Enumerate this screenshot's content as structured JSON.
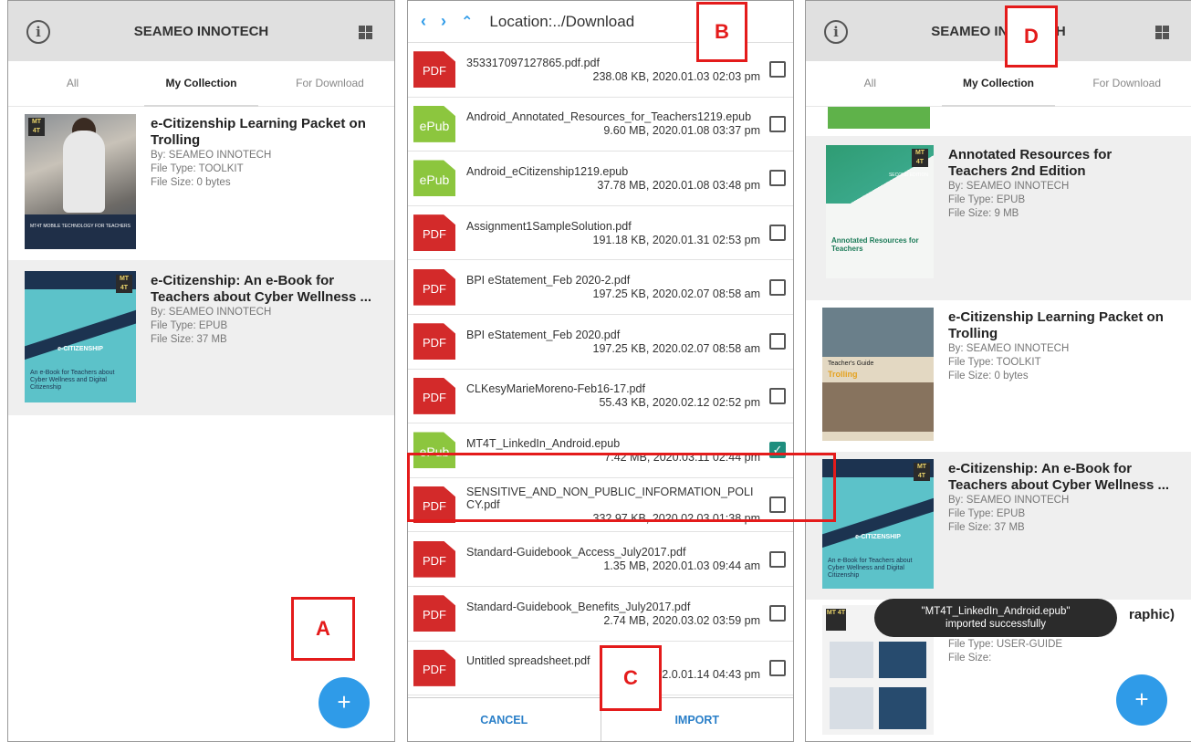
{
  "app": {
    "title": "SEAMEO INNOTECH",
    "info_icon": "info-icon",
    "grid_icon": "grid-view-icon",
    "tabs": [
      "All",
      "My Collection",
      "For Download"
    ]
  },
  "panel1": {
    "cards": [
      {
        "title": "e-Citizenship Learning Packet on Trolling",
        "by": "By: SEAMEO INNOTECH",
        "type": "File Type: TOOLKIT",
        "size": "File Size: 0 bytes",
        "cover_text": "MT4T MOBILE TECHNOLOGY FOR TEACHERS"
      },
      {
        "title": "e-Citizenship: An e-Book for Teachers about Cyber Wellness ...",
        "by": "By: SEAMEO INNOTECH",
        "type": "File Type: EPUB",
        "size": "File Size: 37 MB",
        "cover_text": "e-CITIZENSHIP",
        "cover_note": "An e-Book for Teachers about Cyber Wellness and Digital Citizenship"
      }
    ],
    "fab": "+"
  },
  "panel2": {
    "location": "Location:../Download",
    "files": [
      {
        "icon": "PDF",
        "name": "353317097127865.pdf.pdf",
        "meta": "238.08 KB, 2020.01.03 02:03 pm",
        "checked": false
      },
      {
        "icon": "ePub",
        "name": "Android_Annotated_Resources_for_Teachers1219.epub",
        "meta": "9.60 MB, 2020.01.08 03:37 pm",
        "checked": false
      },
      {
        "icon": "ePub",
        "name": "Android_eCitizenship1219.epub",
        "meta": "37.78 MB, 2020.01.08 03:48 pm",
        "checked": false
      },
      {
        "icon": "PDF",
        "name": "Assignment1SampleSolution.pdf",
        "meta": "191.18 KB, 2020.01.31 02:53 pm",
        "checked": false
      },
      {
        "icon": "PDF",
        "name": "BPI eStatement_Feb 2020-2.pdf",
        "meta": "197.25 KB, 2020.02.07 08:58 am",
        "checked": false
      },
      {
        "icon": "PDF",
        "name": "BPI eStatement_Feb 2020.pdf",
        "meta": "197.25 KB, 2020.02.07 08:58 am",
        "checked": false
      },
      {
        "icon": "PDF",
        "name": "CLKesyMarieMoreno-Feb16-17.pdf",
        "meta": "55.43 KB, 2020.02.12 02:52 pm",
        "checked": false
      },
      {
        "icon": "ePub",
        "name": "MT4T_LinkedIn_Android.epub",
        "meta": "7.42 MB, 2020.03.11 02:44 pm",
        "checked": true
      },
      {
        "icon": "PDF",
        "name": "SENSITIVE_AND_NON_PUBLIC_INFORMATION_POLICY.pdf",
        "meta": "332.97 KB, 2020.02.03 01:38 pm",
        "checked": false
      },
      {
        "icon": "PDF",
        "name": "Standard-Guidebook_Access_July2017.pdf",
        "meta": "1.35 MB, 2020.01.03 09:44 am",
        "checked": false
      },
      {
        "icon": "PDF",
        "name": "Standard-Guidebook_Benefits_July2017.pdf",
        "meta": "2.74 MB, 2020.03.02 03:59 pm",
        "checked": false
      },
      {
        "icon": "PDF",
        "name": "Untitled spreadsheet.pdf",
        "meta": "2.0.01.14 04:43 pm",
        "checked": false
      }
    ],
    "cancel": "CANCEL",
    "import": "IMPORT"
  },
  "panel3": {
    "cards": [
      {
        "title": "Annotated Resources for Teachers 2nd Edition",
        "by": "By: SEAMEO INNOTECH",
        "type": "File Type: EPUB",
        "size": "File Size: 9 MB",
        "cover_note": "Annotated Resources for Teachers",
        "cover_edition": "SECOND EDITION"
      },
      {
        "title": "e-Citizenship Learning Packet on Trolling",
        "by": "By: SEAMEO INNOTECH",
        "type": "File Type: TOOLKIT",
        "size": "File Size: 0 bytes",
        "cover_t1": "Teacher's Guide",
        "cover_t2": "Trolling"
      },
      {
        "title": "e-Citizenship: An e-Book for Teachers about Cyber Wellness ...",
        "by": "By: SEAMEO INNOTECH",
        "type": "File Type: EPUB",
        "size": "File Size: 37 MB",
        "cover_text": "e-CITIZENSHIP",
        "cover_note": "An e-Book for Teachers about Cyber Wellness and Digital Citizenship"
      },
      {
        "title_visible": "raphic)",
        "type": "File Type: USER-GUIDE",
        "size": "File Size:"
      }
    ],
    "toast_line1": "\"MT4T_LinkedIn_Android.epub\"",
    "toast_line2": "imported successfully",
    "fab": "+"
  },
  "annotations": {
    "a": "A",
    "b": "B",
    "c": "C",
    "d": "D"
  },
  "colors": {
    "accent": "#2f9be8",
    "annotation": "#e41b1b",
    "pdf": "#d32a2a",
    "epub": "#8cc63e",
    "checked": "#1e8e7e"
  }
}
